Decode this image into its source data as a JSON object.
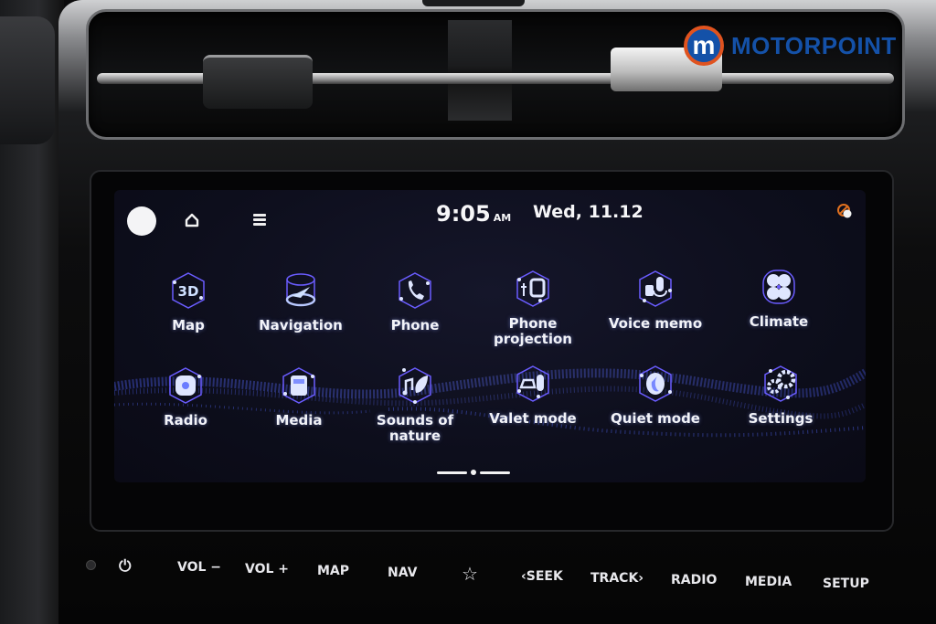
{
  "brand": {
    "name": "MOTORPOINT",
    "mark": "m",
    "primary_color": "#1451a8",
    "ring_color": "#e0531f"
  },
  "status_bar": {
    "time": "9:05",
    "ampm": "AM",
    "date": "Wed, 11.12",
    "avatar_icon": "profile-avatar",
    "home_icon": "home-icon",
    "menu_icon": "menu-icon",
    "status_icon": "muted-status-icon",
    "status_color": "#e0701f"
  },
  "apps": [
    {
      "label": "Map",
      "icon": "map-3d-icon"
    },
    {
      "label": "Navigation",
      "icon": "navigation-icon"
    },
    {
      "label": "Phone",
      "icon": "phone-icon"
    },
    {
      "label": "Phone\nprojection",
      "label_lines": [
        "Phone",
        "projection"
      ],
      "icon": "phone-projection-icon"
    },
    {
      "label": "Voice memo",
      "icon": "voice-memo-icon"
    },
    {
      "label": "Climate",
      "icon": "climate-fan-icon"
    },
    {
      "label": "Radio",
      "icon": "radio-icon"
    },
    {
      "label": "Media",
      "icon": "media-icon"
    },
    {
      "label": "Sounds of\nnature",
      "label_lines": [
        "Sounds of",
        "nature"
      ],
      "icon": "sounds-of-nature-icon"
    },
    {
      "label": "Valet mode",
      "icon": "valet-mode-icon"
    },
    {
      "label": "Quiet mode",
      "icon": "quiet-mode-icon"
    },
    {
      "label": "Settings",
      "icon": "settings-gear-icon"
    }
  ],
  "pager": {
    "pages": 2,
    "current": 1
  },
  "hardware_buttons": [
    {
      "label": "⏻",
      "name": "power-button"
    },
    {
      "label": "VOL −",
      "name": "volume-down-button"
    },
    {
      "label": "VOL +",
      "name": "volume-up-button"
    },
    {
      "label": "MAP",
      "name": "map-button"
    },
    {
      "label": "NAV",
      "name": "nav-button"
    },
    {
      "label": "☆",
      "name": "favorite-button"
    },
    {
      "label": "‹SEEK",
      "name": "seek-button"
    },
    {
      "label": "TRACK›",
      "name": "track-button"
    },
    {
      "label": "RADIO",
      "name": "radio-button"
    },
    {
      "label": "MEDIA",
      "name": "media-button"
    },
    {
      "label": "SETUP",
      "name": "setup-button"
    }
  ],
  "colors": {
    "icon_glow": "#9fb4ff",
    "icon_frame": "#6a5cff",
    "label": "#f2f3f8"
  }
}
